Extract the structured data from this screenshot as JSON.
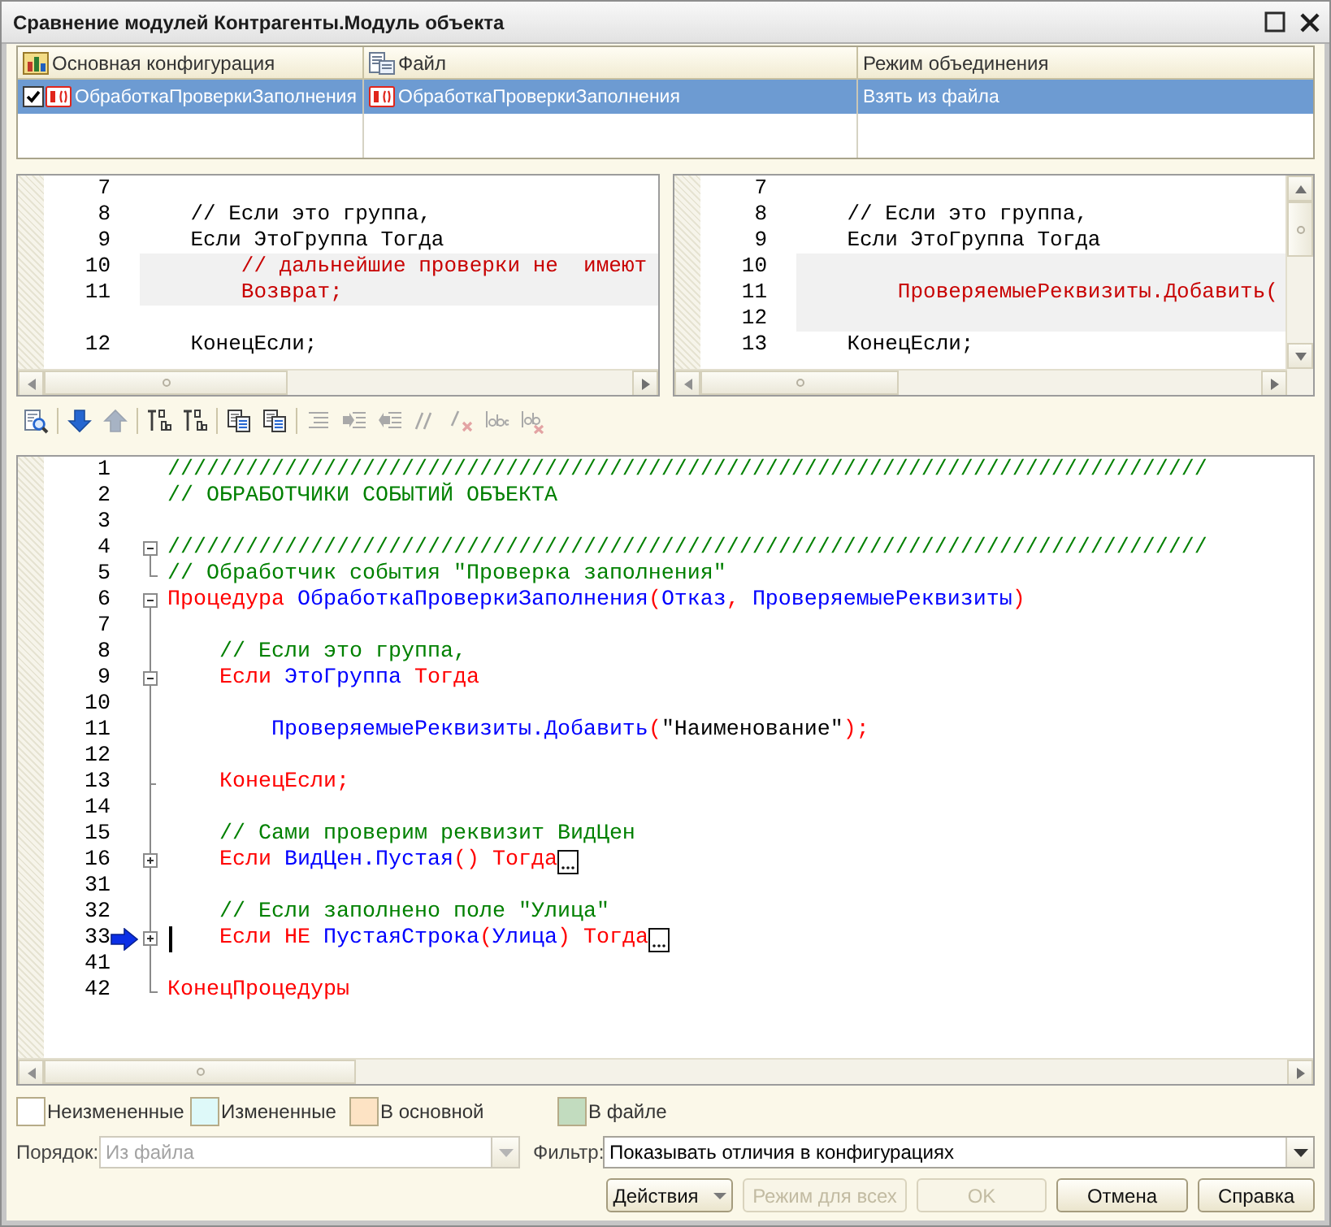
{
  "window": {
    "title": "Сравнение модулей Контрагенты.Модуль объекта"
  },
  "objects_table": {
    "columns": [
      {
        "label": "Основная конфигурация"
      },
      {
        "label": "Файл"
      },
      {
        "label": "Режим объединения"
      }
    ],
    "rows": [
      {
        "selected": true,
        "checked": true,
        "cells": [
          {
            "kind": "procedure",
            "text": "ОбработкаПроверкиЗаполнения"
          },
          {
            "kind": "procedure",
            "text": "ОбработкаПроверкиЗаполнения"
          },
          {
            "kind": "plain",
            "text": "Взять из файла"
          }
        ]
      }
    ]
  },
  "diff_panes": [
    {
      "lines": [
        {
          "number": "7",
          "changed": false
        },
        {
          "number": "8",
          "text": "    // Если это группа,",
          "changed": false
        },
        {
          "number": "9",
          "text": "    Если ЭтоГруппа Тогда",
          "changed": false
        },
        {
          "number": "10",
          "text": "        // дальнейшие проверки не  имеют",
          "changed": true
        },
        {
          "number": "11",
          "text": "        Возврат;",
          "changed": true
        },
        {
          "changed": false
        },
        {
          "number": "12",
          "text": "    КонецЕсли;",
          "changed": false
        }
      ]
    },
    {
      "lines": [
        {
          "number": "7",
          "changed": false
        },
        {
          "number": "8",
          "text": "    // Если это группа,",
          "changed": false
        },
        {
          "number": "9",
          "text": "    Если ЭтоГруппа Тогда",
          "changed": false
        },
        {
          "number": "10",
          "changed": true
        },
        {
          "number": "11",
          "text": "        ПроверяемыеРеквизиты.Добавить(",
          "changed": true
        },
        {
          "number": "12",
          "changed": true
        },
        {
          "number": "13",
          "text": "    КонецЕсли;",
          "changed": false
        }
      ]
    }
  ],
  "toolbar_groups": [
    [
      {
        "kind": "find",
        "disabled": false
      }
    ],
    [
      {
        "kind": "next",
        "disabled": false
      },
      {
        "kind": "prev",
        "disabled": true
      }
    ],
    [
      {
        "kind": "mark",
        "disabled": false
      },
      {
        "kind": "mark",
        "disabled": false
      }
    ],
    [
      {
        "kind": "copy",
        "disabled": false
      },
      {
        "kind": "copy",
        "disabled": false
      }
    ],
    [
      {
        "kind": "lines",
        "disabled": true
      },
      {
        "kind": "indent",
        "disabled": true
      },
      {
        "kind": "outdent",
        "disabled": true
      },
      {
        "kind": "comment",
        "disabled": true
      },
      {
        "kind": "uncomment",
        "disabled": true
      },
      {
        "kind": "text",
        "disabled": true
      },
      {
        "kind": "untext",
        "disabled": true
      }
    ]
  ],
  "code": {
    "lines": [
      {
        "number": "1",
        "kind": "plain",
        "current": false,
        "tokens": [
          {
            "kind": "comment",
            "text": "////////////////////////////////////////////////////////////////////////////////"
          }
        ]
      },
      {
        "number": "2",
        "kind": "plain",
        "current": false,
        "tokens": [
          {
            "kind": "comment",
            "text": "// ОБРАБОТЧИКИ СОБЫТИЙ ОБЪЕКТА"
          }
        ]
      },
      {
        "number": "3",
        "kind": "plain",
        "current": false
      },
      {
        "number": "4",
        "kind": "block_start",
        "current": false,
        "tokens": [
          {
            "kind": "comment",
            "text": "////////////////////////////////////////////////////////////////////////////////"
          }
        ]
      },
      {
        "number": "5",
        "kind": "block_end",
        "current": false,
        "tokens": [
          {
            "kind": "comment",
            "text": "// Обработчик события \"Проверка заполнения\""
          }
        ]
      },
      {
        "number": "6",
        "kind": "block_start",
        "current": false,
        "tokens": [
          {
            "kind": "keyword",
            "text": "Процедура"
          },
          {
            "kind": "name",
            "text": " ОбработкаПроверкиЗаполнения"
          },
          {
            "kind": "op",
            "text": "("
          },
          {
            "kind": "name",
            "text": "Отказ"
          },
          {
            "kind": "op",
            "text": ", "
          },
          {
            "kind": "name",
            "text": "ПроверяемыеРеквизиты"
          },
          {
            "kind": "op",
            "text": ")"
          }
        ]
      },
      {
        "number": "7",
        "kind": "plain",
        "current": false
      },
      {
        "number": "8",
        "kind": "plain",
        "current": false,
        "tokens": [
          {
            "kind": "comment",
            "text": "    // Если это группа,"
          }
        ]
      },
      {
        "number": "9",
        "kind": "block_start",
        "current": false,
        "tokens": [
          {
            "kind": "keyword",
            "text": "    Если"
          },
          {
            "kind": "name",
            "text": " ЭтоГруппа"
          },
          {
            "kind": "keyword",
            "text": " Тогда"
          }
        ]
      },
      {
        "number": "10",
        "kind": "plain",
        "current": false
      },
      {
        "number": "11",
        "kind": "plain",
        "current": false,
        "tokens": [
          {
            "kind": "name",
            "text": "        ПроверяемыеРеквизиты.Добавить"
          },
          {
            "kind": "op",
            "text": "("
          },
          {
            "kind": "string",
            "text": "\"Наименование\""
          },
          {
            "kind": "op",
            "text": ");"
          }
        ]
      },
      {
        "number": "12",
        "kind": "plain",
        "current": false
      },
      {
        "number": "13",
        "kind": "block_end",
        "current": false,
        "tokens": [
          {
            "kind": "keyword",
            "text": "    КонецЕсли;"
          }
        ]
      },
      {
        "number": "14",
        "kind": "plain",
        "current": false
      },
      {
        "number": "15",
        "kind": "plain",
        "current": false,
        "tokens": [
          {
            "kind": "comment",
            "text": "    // Сами проверим реквизит ВидЦен"
          }
        ]
      },
      {
        "number": "16",
        "kind": "collapsed",
        "current": false,
        "tokens": [
          {
            "kind": "keyword",
            "text": "    Если"
          },
          {
            "kind": "name",
            "text": " ВидЦен.Пустая"
          },
          {
            "kind": "op",
            "text": "()"
          },
          {
            "kind": "keyword",
            "text": " Тогда"
          }
        ]
      },
      {
        "number": "31",
        "kind": "plain",
        "current": false
      },
      {
        "number": "32",
        "kind": "plain",
        "current": false,
        "tokens": [
          {
            "kind": "comment",
            "text": "    // Если заполнено поле \"Улица\""
          }
        ]
      },
      {
        "number": "33",
        "kind": "collapsed",
        "current": true,
        "tokens": [
          {
            "kind": "keyword",
            "text": "    Если НЕ"
          },
          {
            "kind": "name",
            "text": " ПустаяСтрока"
          },
          {
            "kind": "op",
            "text": "("
          },
          {
            "kind": "name",
            "text": "Улица"
          },
          {
            "kind": "op",
            "text": ")"
          },
          {
            "kind": "keyword",
            "text": " Тогда"
          }
        ]
      },
      {
        "number": "41",
        "kind": "plain",
        "current": false
      },
      {
        "number": "42",
        "kind": "block_end",
        "current": false,
        "tokens": [
          {
            "kind": "keyword",
            "text": "КонецПроцедуры"
          }
        ]
      }
    ]
  },
  "legend": [
    {
      "label": "Неизмененные",
      "color": "#ffffff"
    },
    {
      "label": "Измененные",
      "color": "#def9f9"
    },
    {
      "label": "В основной",
      "color": "#fde3c4"
    },
    {
      "label": "В файле",
      "color": "#c2dcbf"
    }
  ],
  "order": {
    "label": "Порядок:",
    "value": "Из файла",
    "disabled": true
  },
  "filter": {
    "label": "Фильтр:",
    "value": "Показывать отличия в конфигурациях",
    "disabled": false
  },
  "buttons": [
    {
      "label": "Действия",
      "kind": "menu",
      "disabled": false
    },
    {
      "label": "Режим для всех",
      "kind": "plain",
      "disabled": true
    },
    {
      "label": "OK",
      "kind": "plain",
      "disabled": true
    },
    {
      "label": "Отмена",
      "kind": "plain",
      "disabled": false
    },
    {
      "label": "Справка",
      "kind": "plain",
      "disabled": false
    }
  ]
}
